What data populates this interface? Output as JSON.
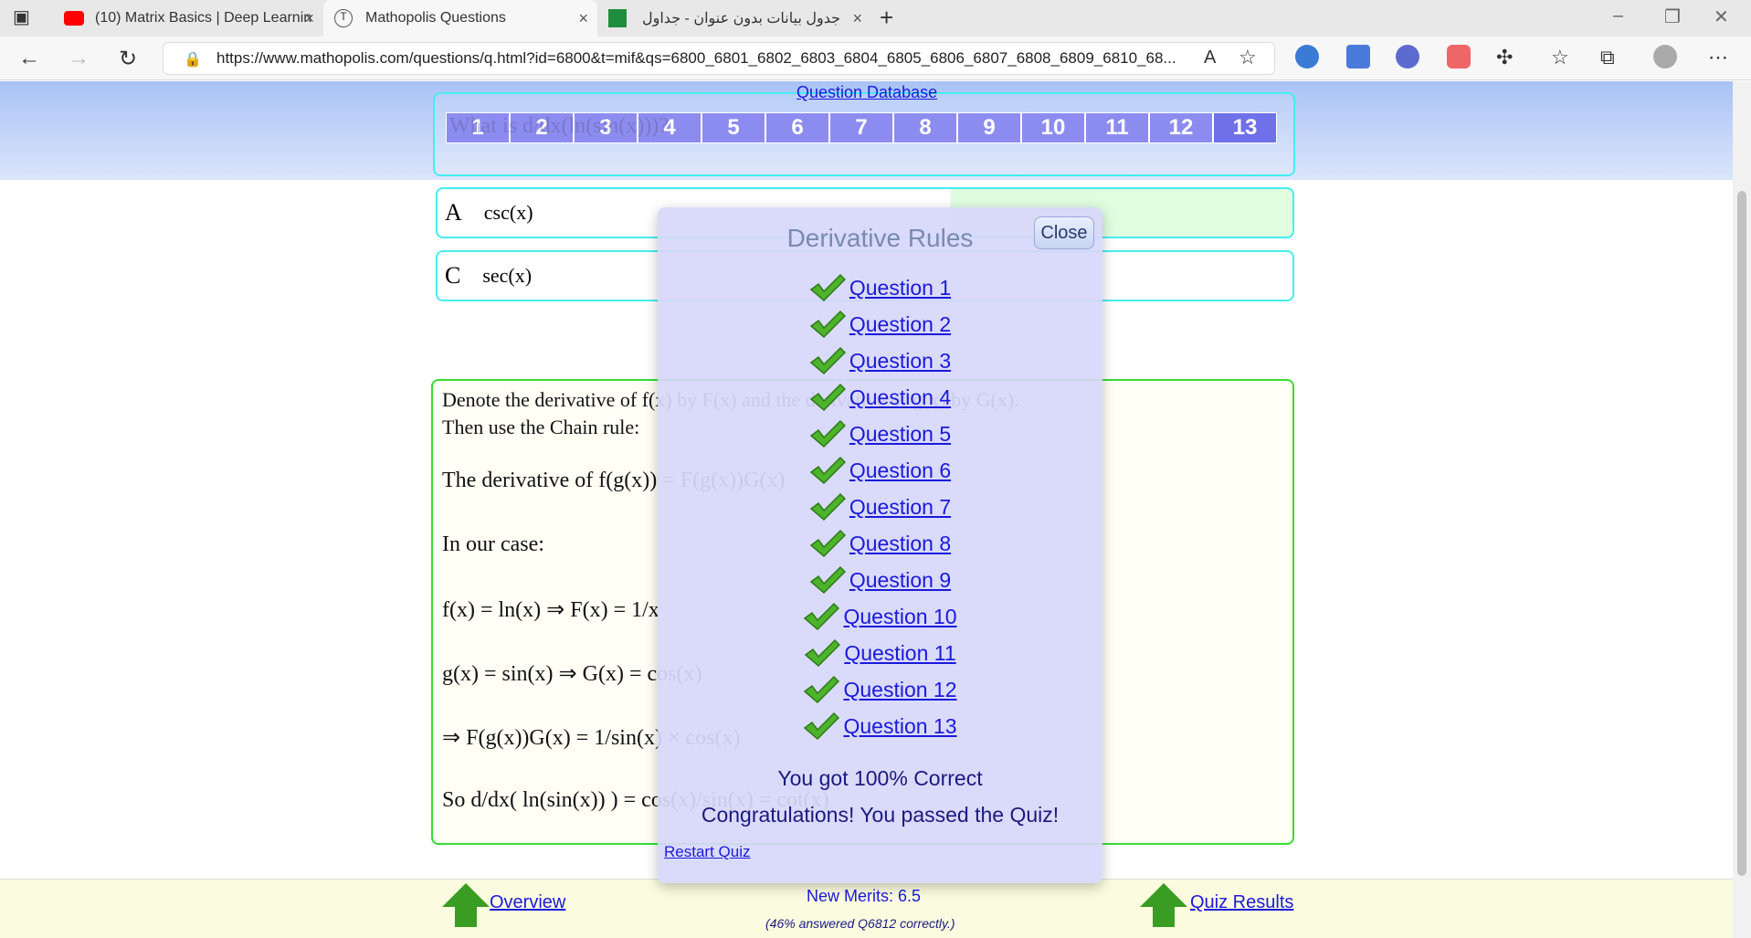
{
  "browser": {
    "tabs": [
      {
        "title": "(10) Matrix Basics | Deep Learnin"
      },
      {
        "title": "Mathopolis Questions"
      },
      {
        "title": "جدول بيانات بدون عنوان - جداول ب"
      }
    ],
    "url_full": "https://www.mathopolis.com/questions/q.html?id=6800&t=mif&qs=6800_6801_6802_6803_6804_6805_6806_6807_6808_6809_6810_68..."
  },
  "page": {
    "question_database": "Question Database",
    "question_nav": [
      "1",
      "2",
      "3",
      "4",
      "5",
      "6",
      "7",
      "8",
      "9",
      "10",
      "11",
      "12",
      "13"
    ],
    "question_ghost": "What is d/dx(ln(sin(x)))?",
    "answers": [
      {
        "letter": "A",
        "text": "csc(x)"
      },
      {
        "letter": "C",
        "text": "sec(x)"
      }
    ],
    "solution_lines": [
      "Denote the derivative of f(x) by F(x) and the derivative of g(x) by G(x).",
      "Then use the Chain rule:",
      "The derivative of f(g(x)) = F(g(x))G(x)",
      "In our case:",
      "f(x) = ln(x) ⇒ F(x) = 1/x",
      "g(x) = sin(x) ⇒ G(x) = cos(x)",
      "⇒ F(g(x))G(x) = 1/sin(x) × cos(x)",
      "So d/dx( ln(sin(x)) ) = cos(x)/sin(x) = cot(x)"
    ],
    "footer": {
      "overview": "Overview",
      "merits": "New Merits: 6.5",
      "answered": "(46% answered Q6812 correctly.)",
      "quiz_results": "Quiz Results"
    }
  },
  "dialog": {
    "title": "Derivative Rules",
    "close": "Close",
    "questions": [
      "Question 1",
      "Question 2",
      "Question 3",
      "Question 4",
      "Question 5",
      "Question 6",
      "Question 7",
      "Question 8",
      "Question 9",
      "Question 10",
      "Question 11",
      "Question 12",
      "Question 13"
    ],
    "score": "You got 100% Correct",
    "congrats": "Congratulations! You passed the Quiz!",
    "restart": "Restart Quiz"
  },
  "colors": {
    "accent": "#1a1adb",
    "check": "#3a9d23",
    "nav": "#8c8cf0"
  }
}
